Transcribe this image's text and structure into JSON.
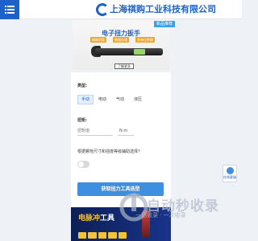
{
  "header": {
    "company_name": "上海祺购工业科技有限公司",
    "menu_icon": "list-menu-icon",
    "logo_icon": "company-logo-icon"
  },
  "banner": {
    "badge": "新品推荐",
    "title": "电子扭力扳手",
    "features": [
      "精确测量",
      "数据存储",
      "多单位转换"
    ],
    "caption": "了解更多"
  },
  "form": {
    "type_label": "类型:",
    "type_options": [
      "手动",
      "电动",
      "气动",
      "液压"
    ],
    "type_selected": "手动",
    "torque_label": "扭矩:",
    "torque_placeholder": "扭矩值",
    "torque_unit": "N.m",
    "question": "根据螺栓尺寸和强度等级辅助选择?",
    "toggle_on": false,
    "submit_label": "获取扭力工具选型"
  },
  "ad": {
    "title_part1": "电脉冲",
    "title_part2": "工具"
  },
  "float_button": {
    "label": "在线客服",
    "icon": "customer-service-icon"
  },
  "watermark": {
    "text": "自动秒收录",
    "sub": "一站收录 · 一次收录"
  },
  "colors": {
    "brand": "#1d62c9",
    "accent": "#3e8fe0",
    "ad_bg": "#0c1f55"
  }
}
